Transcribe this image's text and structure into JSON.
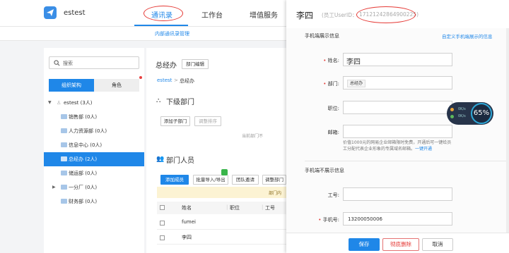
{
  "header": {
    "company": "estest",
    "tabs": [
      "通讯录",
      "工作台",
      "增值服务"
    ],
    "active_tab": "通讯录",
    "sub_link": "内部通讯录管理"
  },
  "sidebar": {
    "search_placeholder": "搜索",
    "seg_org": "组织架构",
    "seg_role": "角色",
    "root": "estest (3人)",
    "items": [
      {
        "label": "销售部 (0人)",
        "selected": false
      },
      {
        "label": "人力资源部 (0人)",
        "selected": false
      },
      {
        "label": "信息中心 (0人)",
        "selected": false
      },
      {
        "label": "总经办 (2人)",
        "selected": true
      },
      {
        "label": "储运部 (0人)",
        "selected": false
      },
      {
        "label": "一分厂 (0人)",
        "selected": false
      },
      {
        "label": "财务部 (0人)",
        "selected": false
      }
    ]
  },
  "main": {
    "title": "总经办",
    "edit_dept": "部门编辑",
    "crumb_root": "estest",
    "crumb_sep": ">",
    "crumb_current": "总经办",
    "sub_dept_title": "下级部门",
    "add_sub_dept": "添加子部门",
    "adjust_order": "调整排序",
    "hint_partial": "当前部门不",
    "members_title": "部门人员",
    "add_member": "添加成员",
    "batch_import": "批量导入/导出",
    "team_invite": "团队邀请",
    "adjust_dept": "调整部门",
    "notice_partial": "部门内",
    "columns": [
      "姓名",
      "职位",
      "工号"
    ],
    "rows": [
      {
        "name": "fumei"
      },
      {
        "name": "李四"
      }
    ]
  },
  "drawer": {
    "name": "李四",
    "uid_label": "(员工UserID：",
    "uid_value": "17121242864900225)",
    "visible_section": "手机端展示信息",
    "custom_link": "自定义手机端展示的信息",
    "fields": {
      "name_label": "姓名:",
      "name_value": "李四",
      "dept_label": "部门:",
      "dept_value": "总经办",
      "position_label": "职位:",
      "email_label": "邮箱:"
    },
    "email_note": "价值1000元的网易企业邮箱限时免费，开通后可一键给员工分配代表企业形象的专属域名邮箱。",
    "email_note_link": "一键开通",
    "hidden_section": "手机端不展示信息",
    "job_no_label": "工号:",
    "phone_label": "手机号:",
    "phone_value": "13200050006",
    "save": "保存",
    "delete": "彻底删除",
    "cancel": "取消"
  },
  "overlay_gauge": {
    "percent": "65%",
    "up": "0K/s",
    "down": "0K/s"
  }
}
